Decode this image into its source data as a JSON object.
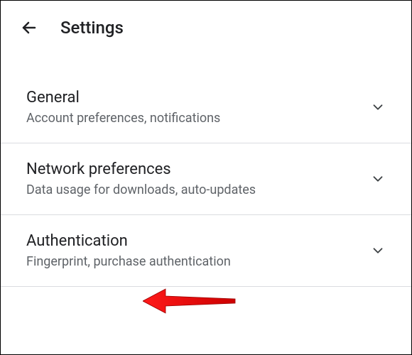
{
  "header": {
    "title": "Settings"
  },
  "items": [
    {
      "title": "General",
      "subtitle": "Account preferences, notifications"
    },
    {
      "title": "Network preferences",
      "subtitle": "Data usage for downloads, auto-updates"
    },
    {
      "title": "Authentication",
      "subtitle": "Fingerprint, purchase authentication"
    }
  ]
}
